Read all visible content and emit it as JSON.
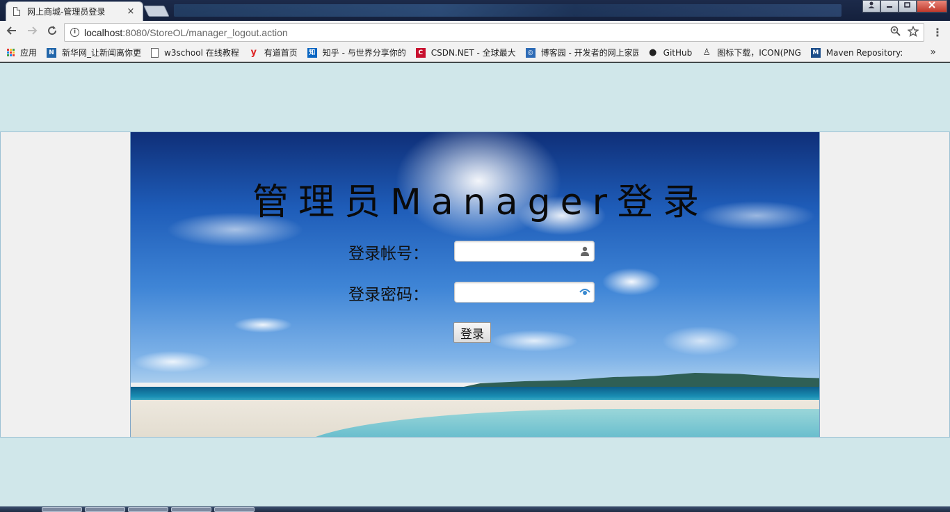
{
  "browser": {
    "tab_title": "网上商城-管理员登录",
    "tab_close": "×",
    "url_host": "localhost",
    "url_rest": ":8080/StoreOL/manager_logout.action",
    "zoom_icon": "zoom-icon",
    "star_icon": "star-icon",
    "menu_icon": "⋮",
    "window_controls": [
      "user",
      "minimize",
      "restore",
      "close"
    ]
  },
  "bookmarks": [
    {
      "label": "应用",
      "icon": "apps-grid-icon"
    },
    {
      "label": "新华网_让新闻离你更",
      "icon": "news-icon",
      "badge": "N",
      "color": "#2266aa"
    },
    {
      "label": "w3school 在线教程",
      "icon": "document-icon",
      "badge": "",
      "color": "#ffffff"
    },
    {
      "label": "有道首页",
      "icon": "youdao-icon",
      "badge": "y",
      "color": "#d22"
    },
    {
      "label": "知乎 - 与世界分享你的",
      "icon": "zhihu-icon",
      "badge": "知",
      "color": "#0a66c2"
    },
    {
      "label": "CSDN.NET - 全球最大",
      "icon": "csdn-icon",
      "badge": "C",
      "color": "#c8102e"
    },
    {
      "label": "博客园 - 开发者的网上家园",
      "icon": "cnblogs-icon",
      "badge": "◎",
      "color": "#2d6bb6"
    },
    {
      "label": "GitHub",
      "icon": "github-icon",
      "badge": "●",
      "color": "#222"
    },
    {
      "label": "图标下载，ICON(PNG",
      "icon": "icon-download-icon",
      "badge": "♙",
      "color": "#444"
    },
    {
      "label": "Maven Repository: ",
      "icon": "maven-icon",
      "badge": "M",
      "color": "#1d4e8a"
    }
  ],
  "bookmarks_more": "»",
  "login": {
    "title": "管理员Manager登录",
    "account_label": "登录帐号：",
    "password_label": "登录密码：",
    "account_value": "",
    "password_value": "",
    "submit_label": "登录"
  }
}
